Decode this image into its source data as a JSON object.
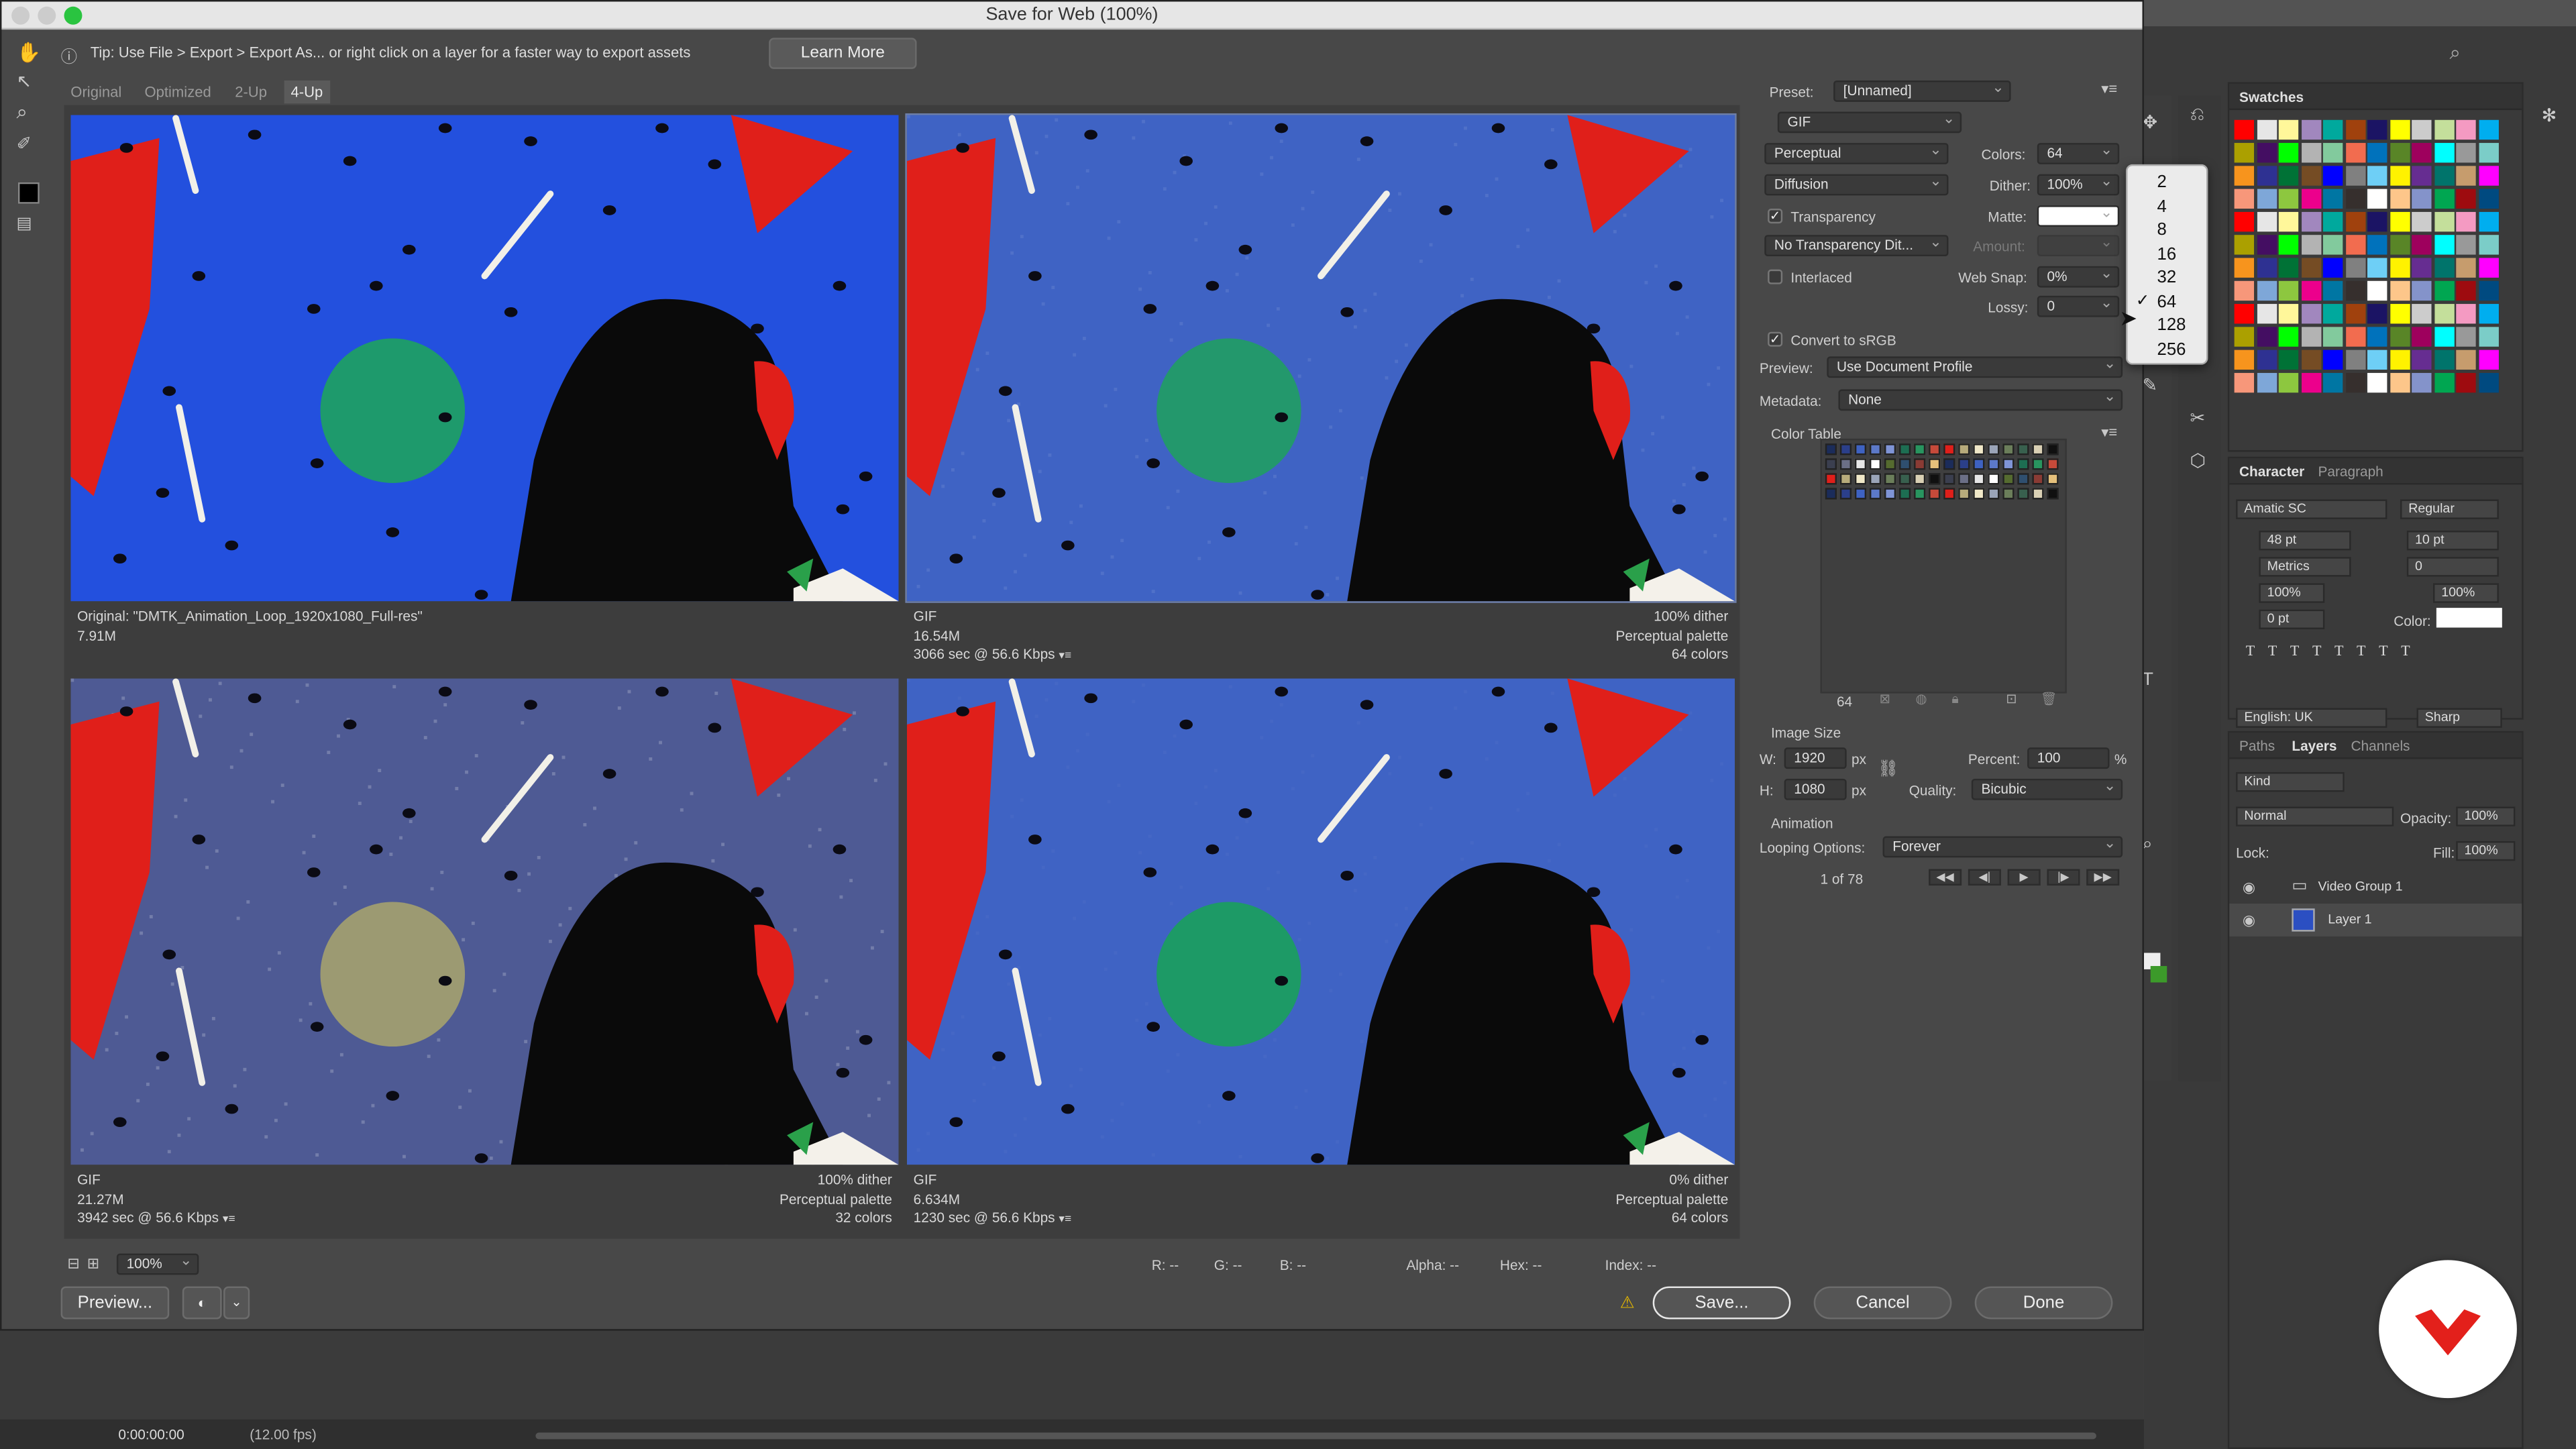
{
  "window_title": "Save for Web (100%)",
  "tip": {
    "text": "Tip: Use File > Export > Export As...  or right click on a layer for a faster way to export assets",
    "learn_more": "Learn More"
  },
  "tabs": [
    "Original",
    "Optimized",
    "2-Up",
    "4-Up"
  ],
  "active_tab": "4-Up",
  "panes": [
    {
      "left": [
        "Original: \"DMTK_Animation_Loop_1920x1080_Full-res\"",
        "7.91M"
      ],
      "right": []
    },
    {
      "left": [
        "GIF",
        "16.54M",
        "3066 sec @ 56.6 Kbps"
      ],
      "right": [
        "100% dither",
        "Perceptual palette",
        "64 colors"
      ]
    },
    {
      "left": [
        "GIF",
        "21.27M",
        "3942 sec @ 56.6 Kbps"
      ],
      "right": [
        "100% dither",
        "Perceptual palette",
        "32 colors"
      ]
    },
    {
      "left": [
        "GIF",
        "6.634M",
        "1230 sec @ 56.6 Kbps"
      ],
      "right": [
        "0% dither",
        "Perceptual palette",
        "64 colors"
      ]
    }
  ],
  "status": {
    "zoom": "100%",
    "r": "R: --",
    "g": "G: --",
    "b": "B: --",
    "alpha": "Alpha: --",
    "hex": "Hex: --",
    "index": "Index: --"
  },
  "buttons": {
    "preview": "Preview...",
    "save": "Save...",
    "cancel": "Cancel",
    "done": "Done"
  },
  "settings": {
    "preset_label": "Preset:",
    "preset": "[Unnamed]",
    "format": "GIF",
    "reduction": "Perceptual",
    "colors_label": "Colors:",
    "colors": "64",
    "dither_algo": "Diffusion",
    "dither_label": "Dither:",
    "dither": "100%",
    "transparency": "Transparency",
    "matte_label": "Matte:",
    "trans_dither": "No Transparency Dit...",
    "amount_label": "Amount:",
    "interlaced": "Interlaced",
    "websnap_label": "Web Snap:",
    "websnap": "0%",
    "lossy_label": "Lossy:",
    "lossy": "0",
    "convert_srgb": "Convert to sRGB",
    "preview_label": "Preview:",
    "preview_value": "Use Document Profile",
    "metadata_label": "Metadata:",
    "metadata_value": "None",
    "color_table_title": "Color Table",
    "color_count": "64",
    "image_size_title": "Image Size",
    "w_label": "W:",
    "w": "1920",
    "h_label": "H:",
    "h": "1080",
    "px": "px",
    "percent_label": "Percent:",
    "percent": "100",
    "pct": "%",
    "quality_label": "Quality:",
    "quality": "Bicubic",
    "animation_title": "Animation",
    "looping_label": "Looping Options:",
    "looping": "Forever",
    "frame": "1 of 78"
  },
  "colors_menu": {
    "options": [
      "2",
      "4",
      "8",
      "16",
      "32",
      "64",
      "128",
      "256"
    ],
    "checked": "64"
  },
  "ps": {
    "swatches_tab": "Swatches",
    "character_tab": "Character",
    "paragraph_tab": "Paragraph",
    "font": "Amatic SC",
    "style": "Regular",
    "size": "48 pt",
    "leading": "10 pt",
    "kerning": "Metrics",
    "tracking": "0",
    "vscale": "100%",
    "hscale": "100%",
    "baseline": "0 pt",
    "color_label": "Color:",
    "language": "English: UK",
    "aa": "Sharp",
    "paths_tab": "Paths",
    "layers_tab": "Layers",
    "channels_tab": "Channels",
    "kind": "Kind",
    "blend": "Normal",
    "opacity_label": "Opacity:",
    "opacity": "100%",
    "lock_label": "Lock:",
    "fill_label": "Fill:",
    "fill": "100%",
    "layers": [
      "Video Group 1",
      "Layer 1"
    ],
    "timecode": "0:00:00:00",
    "fps": "(12.00 fps)"
  },
  "colors_accent": {
    "blue_bright": "#2350de",
    "blue_muted": "#3f63c4",
    "red": "#e01f1a",
    "green": "#1e9a6c",
    "brand_red": "#e3201b"
  }
}
